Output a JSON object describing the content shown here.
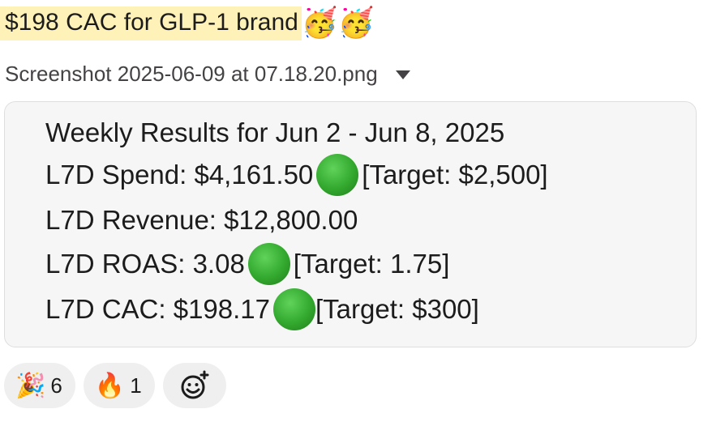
{
  "message": {
    "headline": "$198 CAC for GLP-1 brand",
    "headline_emojis": [
      "🥳",
      "🥳"
    ],
    "file_name": "Screenshot 2025-06-09 at 07.18.20.png"
  },
  "results": {
    "title": "Weekly Results for Jun 2 - Jun 8, 2025",
    "spend_label": "L7D Spend: $4,161.50",
    "spend_target": "[Target: $2,500]",
    "revenue_label": "L7D Revenue: $12,800.00",
    "roas_label": "L7D ROAS: 3.08",
    "roas_target": "[Target: 1.75]",
    "cac_label": "L7D CAC: $198.17",
    "cac_target": "[Target: $300]",
    "status_icon": "green-circle",
    "status_color": "#33a82e"
  },
  "reactions": [
    {
      "emoji": "🎉",
      "icon": "party-popper-icon",
      "count": "6"
    },
    {
      "emoji": "🔥",
      "icon": "fire-icon",
      "count": "1"
    }
  ],
  "add_reaction": {
    "icon": "add-reaction-icon"
  }
}
